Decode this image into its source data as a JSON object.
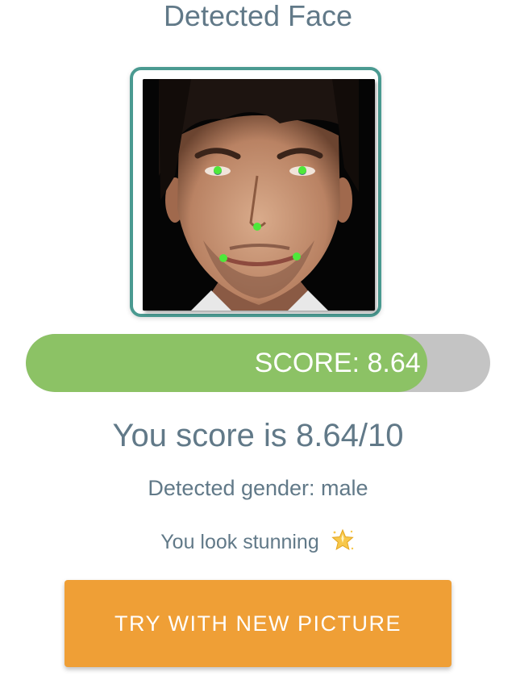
{
  "header": {
    "title": "Detected Face"
  },
  "face": {
    "landmark_color": "#4ee83a",
    "frame_color": "#4a9a91"
  },
  "score_bar": {
    "label": "SCORE: 8.64",
    "value": 8.64,
    "max": 10,
    "fill_color": "#8cc265",
    "track_color": "#c4c4c4"
  },
  "result": {
    "score_text": "You score is 8.64/10",
    "gender_text": "Detected gender: male",
    "comment_text": "You look stunning",
    "comment_icon": "sparkle-star-icon"
  },
  "actions": {
    "try_again_label": "TRY WITH NEW PICTURE",
    "button_color": "#ef9f36"
  }
}
